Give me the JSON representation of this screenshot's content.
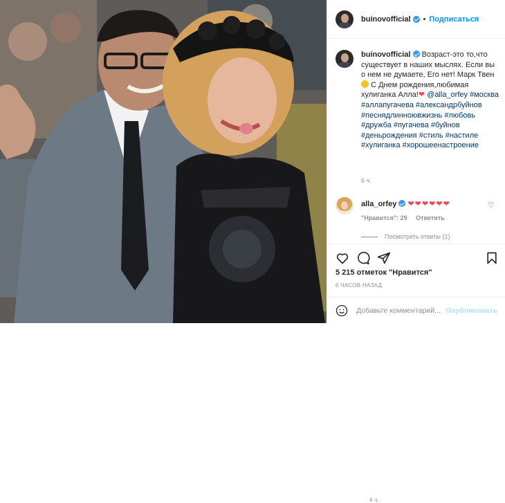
{
  "post": {
    "username": "buinovofficial",
    "follow_label": "Подписаться",
    "separator": "•"
  },
  "caption": {
    "username": "buinovofficial",
    "text_parts": [
      "Возраст-это то,что существует в наших мыслях. Если вы о нем не думаете, Его нет! Марк Твен",
      " С Днем рождения,любимая хулиганка Алла!",
      " @alla_orfey",
      " #москва #аллапугачева #александрбуйнов #песнядлинноювжизнь #любовь #дружба #пугачева #буйнов #деньрождения #стиль #настиле #хулиганка #хорошеенастроение"
    ],
    "time": "6 ч."
  },
  "comment": {
    "username": "alla_orfey",
    "hearts": "❤❤❤❤❤❤",
    "time": "4 ч.",
    "likes": "\"Нравится\": 29",
    "reply": "Ответить",
    "view_replies": "Посмотреть ответы (1)"
  },
  "actions": {
    "icons": [
      "heart-icon",
      "comment-icon",
      "share-icon",
      "bookmark-icon"
    ]
  },
  "likes": "5 215 отметок \"Нравится\"",
  "timestamp": "6 ЧАСОВ НАЗАД",
  "add_comment": {
    "placeholder": "Добавьте комментарий...",
    "publish_label": "Опубликовать"
  },
  "colors": {
    "link": "#0095f6",
    "hashtag": "#00376b",
    "muted": "#8e8e8e",
    "heart": "#ed4956",
    "border": "#efefef"
  }
}
